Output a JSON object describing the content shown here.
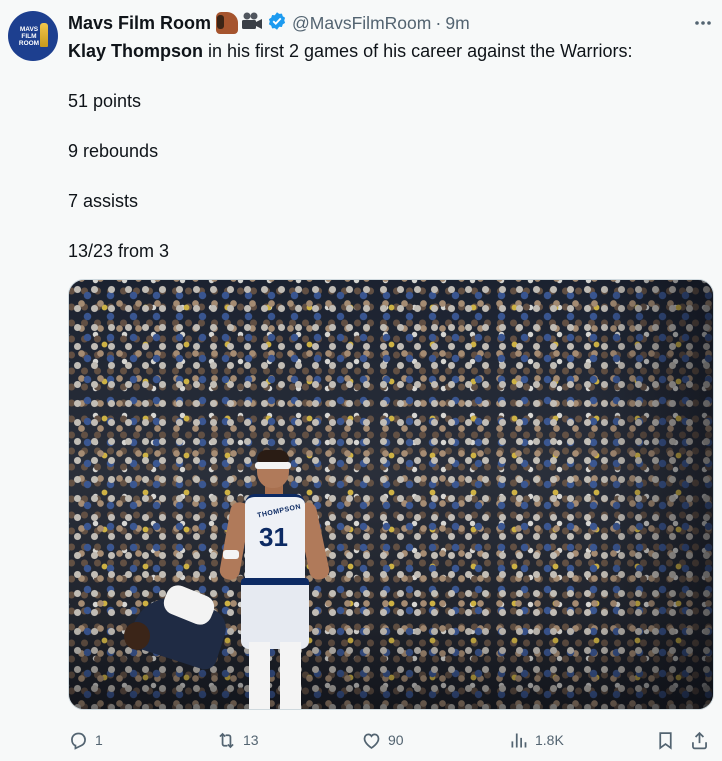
{
  "author": {
    "name": "Mavs Film Room",
    "handle": "@MavsFilmRoom",
    "separator": "·",
    "time": "9m",
    "avatar_text": "MAVS FILM ROOM",
    "emojis": [
      "horse-face-icon",
      "movie-camera-icon"
    ],
    "verified_color": "#1d9bf0"
  },
  "tweet": {
    "mention": "Klay Thompson",
    "line1_rest": " in his first 2 games of his career against the Warriors:",
    "stats": [
      "51 points",
      "9 rebounds",
      "7 assists",
      "13/23 from 3"
    ]
  },
  "media": {
    "jersey_name": "THOMPSON",
    "jersey_number": "31"
  },
  "actions": {
    "reply_count": "1",
    "retweet_count": "13",
    "like_count": "90",
    "view_count": "1.8K"
  },
  "colors": {
    "text_primary": "#0f1419",
    "text_secondary": "#536471",
    "background": "#f7f9f9"
  }
}
